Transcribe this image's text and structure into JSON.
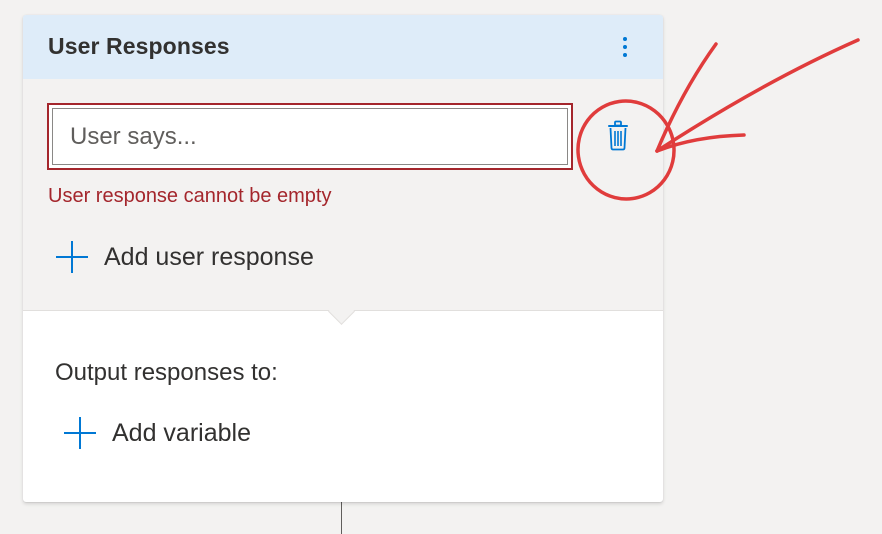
{
  "card": {
    "title": "User Responses",
    "menu_icon": "more-vertical-icon"
  },
  "user_response": {
    "placeholder": "User says...",
    "value": "",
    "delete_icon": "trash-icon",
    "error": "User response cannot be empty"
  },
  "add_user_response": {
    "icon": "plus-icon",
    "label": "Add user response"
  },
  "output": {
    "label": "Output responses to:",
    "add_variable": {
      "icon": "plus-icon",
      "label": "Add variable"
    }
  },
  "colors": {
    "header_bg": "#deecf9",
    "accent": "#0078d4",
    "error": "#a4262c",
    "annotation": "#e03c3c"
  }
}
